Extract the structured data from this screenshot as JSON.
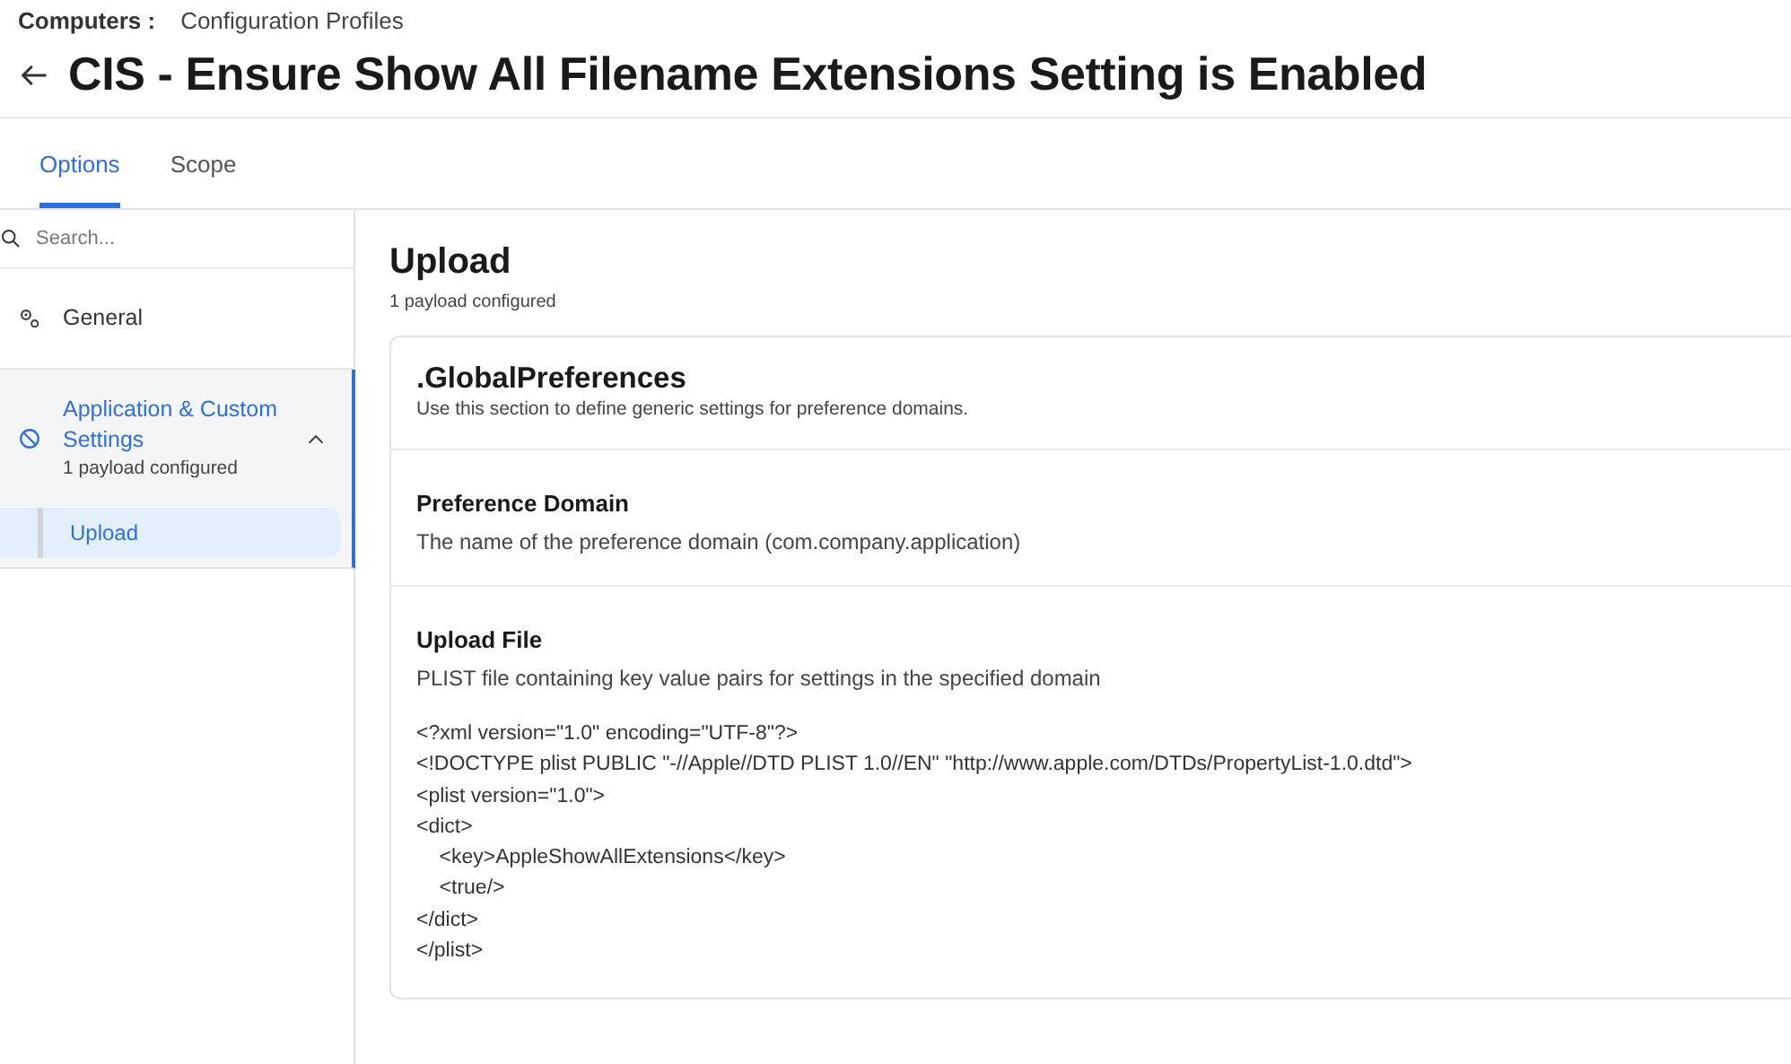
{
  "breadcrumb": {
    "parent": "Computers :",
    "current": "Configuration Profiles"
  },
  "title": "CIS - Ensure Show All Filename Extensions Setting is Enabled",
  "tabs": [
    {
      "label": "Options",
      "selected": true
    },
    {
      "label": "Scope",
      "selected": false
    }
  ],
  "sidebar": {
    "search": {
      "placeholder": "Search..."
    },
    "items": [
      {
        "kind": "gear",
        "label": "General",
        "selected": false
      },
      {
        "kind": "block",
        "label": "Application & Custom Settings",
        "subtitle": "1 payload configured",
        "selected": true,
        "expanded": true,
        "children": [
          {
            "label": "Upload",
            "selected": true
          }
        ]
      }
    ]
  },
  "main": {
    "heading": "Upload",
    "subtitle": "1 payload configured",
    "card": {
      "title": ".GlobalPreferences",
      "description": "Use this section to define generic settings for preference domains.",
      "sections": [
        {
          "title": "Preference Domain",
          "description": "The name of the preference domain (com.company.application)"
        },
        {
          "title": "Upload File",
          "description": "PLIST file containing key value pairs for settings in the specified domain",
          "code": [
            "<?xml version=\"1.0\" encoding=\"UTF-8\"?>",
            "<!DOCTYPE plist PUBLIC \"-//Apple//DTD PLIST 1.0//EN\" \"http://www.apple.com/DTDs/PropertyList-1.0.dtd\">",
            "<plist version=\"1.0\">",
            "<dict>",
            "\t<key>AppleShowAllExtensions</key>",
            "\t<true/>",
            "</dict>",
            "</plist>"
          ]
        }
      ]
    }
  }
}
